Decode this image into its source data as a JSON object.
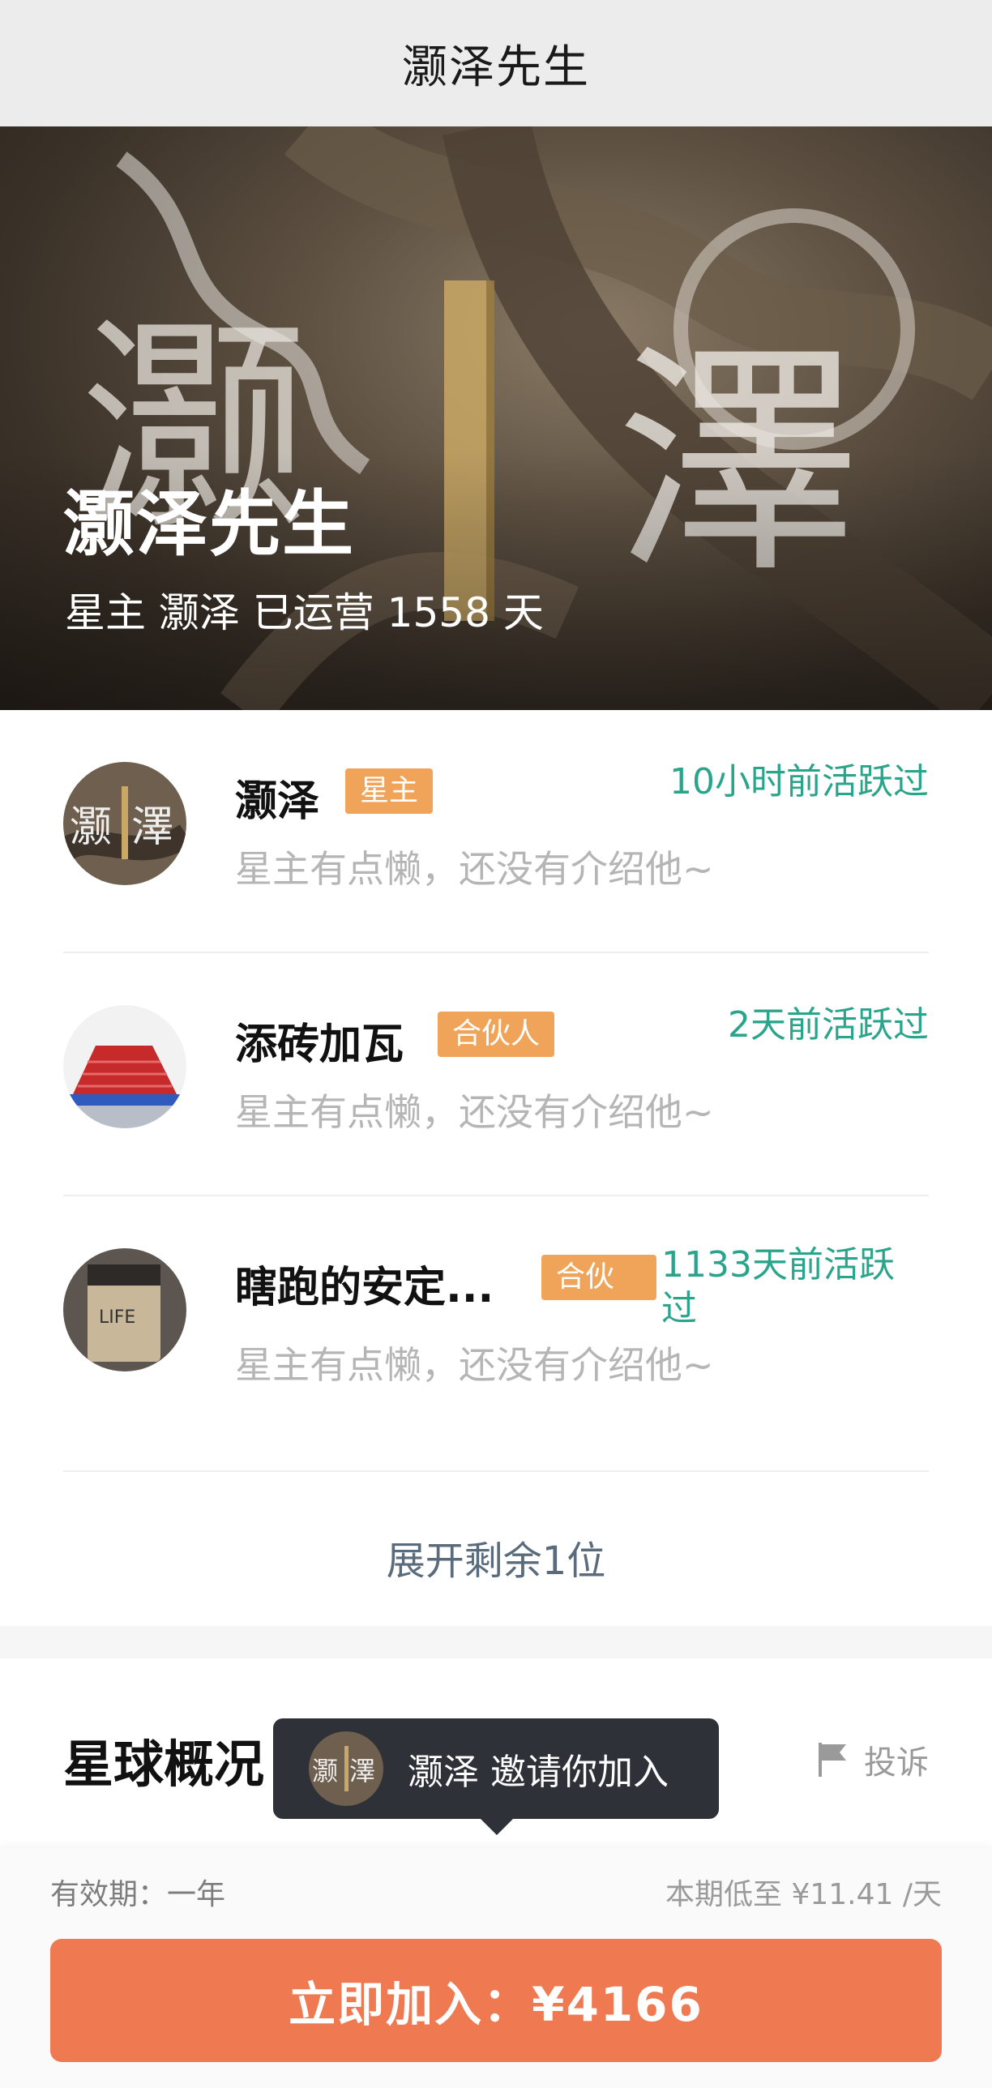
{
  "header": {
    "title": "灏泽先生"
  },
  "hero": {
    "name": "灏泽先生",
    "subtitle": "星主 灏泽 已运营 1558 天",
    "banner_chars": [
      "灏",
      "澤"
    ]
  },
  "members": [
    {
      "name": "灏泽",
      "badge": "星主",
      "active": "10小时前活跃过",
      "intro": "星主有点懒，还没有介绍他~",
      "avatar_chars": [
        "灏",
        "澤"
      ]
    },
    {
      "name": "添砖加瓦",
      "badge": "合伙人",
      "active": "2天前活跃过",
      "intro": "星主有点懒，还没有介绍他~"
    },
    {
      "name": "瞎跑的安定...",
      "badge": "合伙",
      "active": "1133天前活跃过",
      "intro": "星主有点懒，还没有介绍他~",
      "avatar_text": "LIFE"
    }
  ],
  "expand_label": "展开剩余1位",
  "overview": {
    "title": "星球概况",
    "report_label": "投诉"
  },
  "toast": {
    "text": "灏泽 邀请你加入"
  },
  "footer": {
    "validity": "有效期：一年",
    "daily_price": "本期低至 ¥11.41 /天",
    "join_label": "立即加入：¥4166"
  },
  "colors": {
    "accent": "#ef7a52",
    "badge": "#f0a45a",
    "active": "#2aa58b"
  }
}
